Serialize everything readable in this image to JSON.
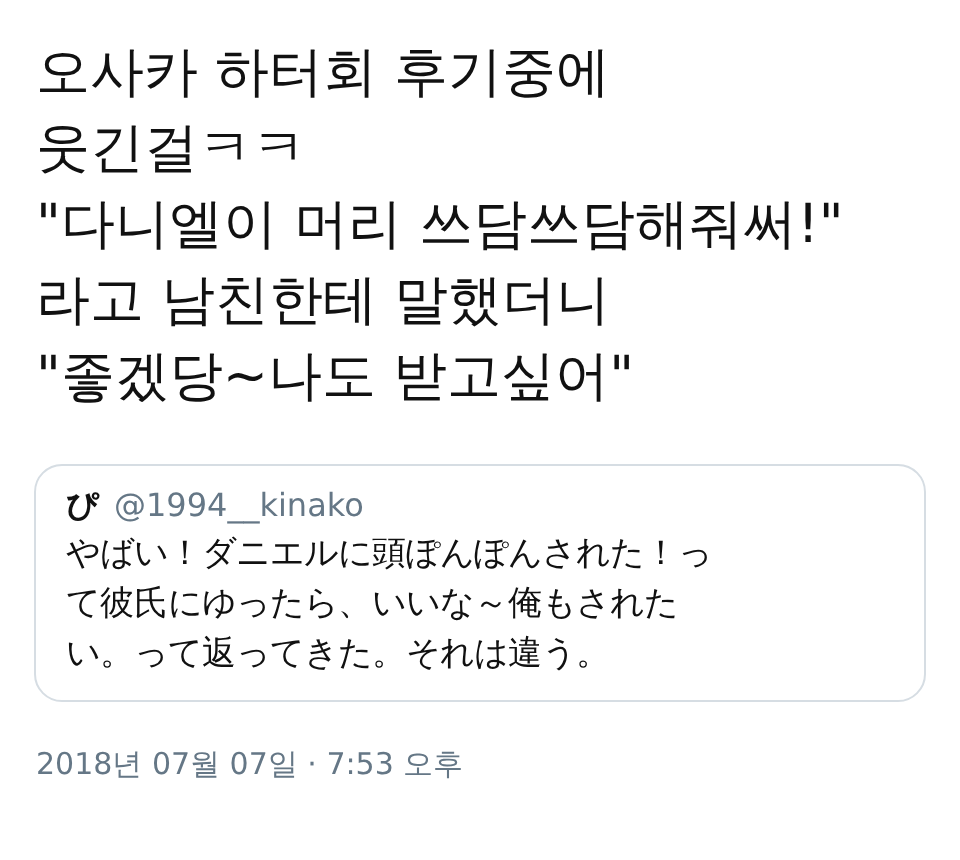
{
  "tweet_lines": [
    "오사카 하터회 후기중에",
    "웃긴걸ㅋㅋ",
    "\"다니엘이 머리 쓰담쓰담해줘써!\"",
    "라고 남친한테 말했더니",
    "\"좋겠당~나도 받고싶어\""
  ],
  "quoted_tweet": {
    "name": "ぴ",
    "handle": "@1994__kinako",
    "lines": [
      "やばい！ダニエルに頭ぽんぽんされた！っ",
      "て彼氏にゆったら、いいな～俺もされた",
      "い。って返ってきた。それは違う。"
    ]
  },
  "timestamp": "2018년 07월 07일 · 7:53 오후"
}
